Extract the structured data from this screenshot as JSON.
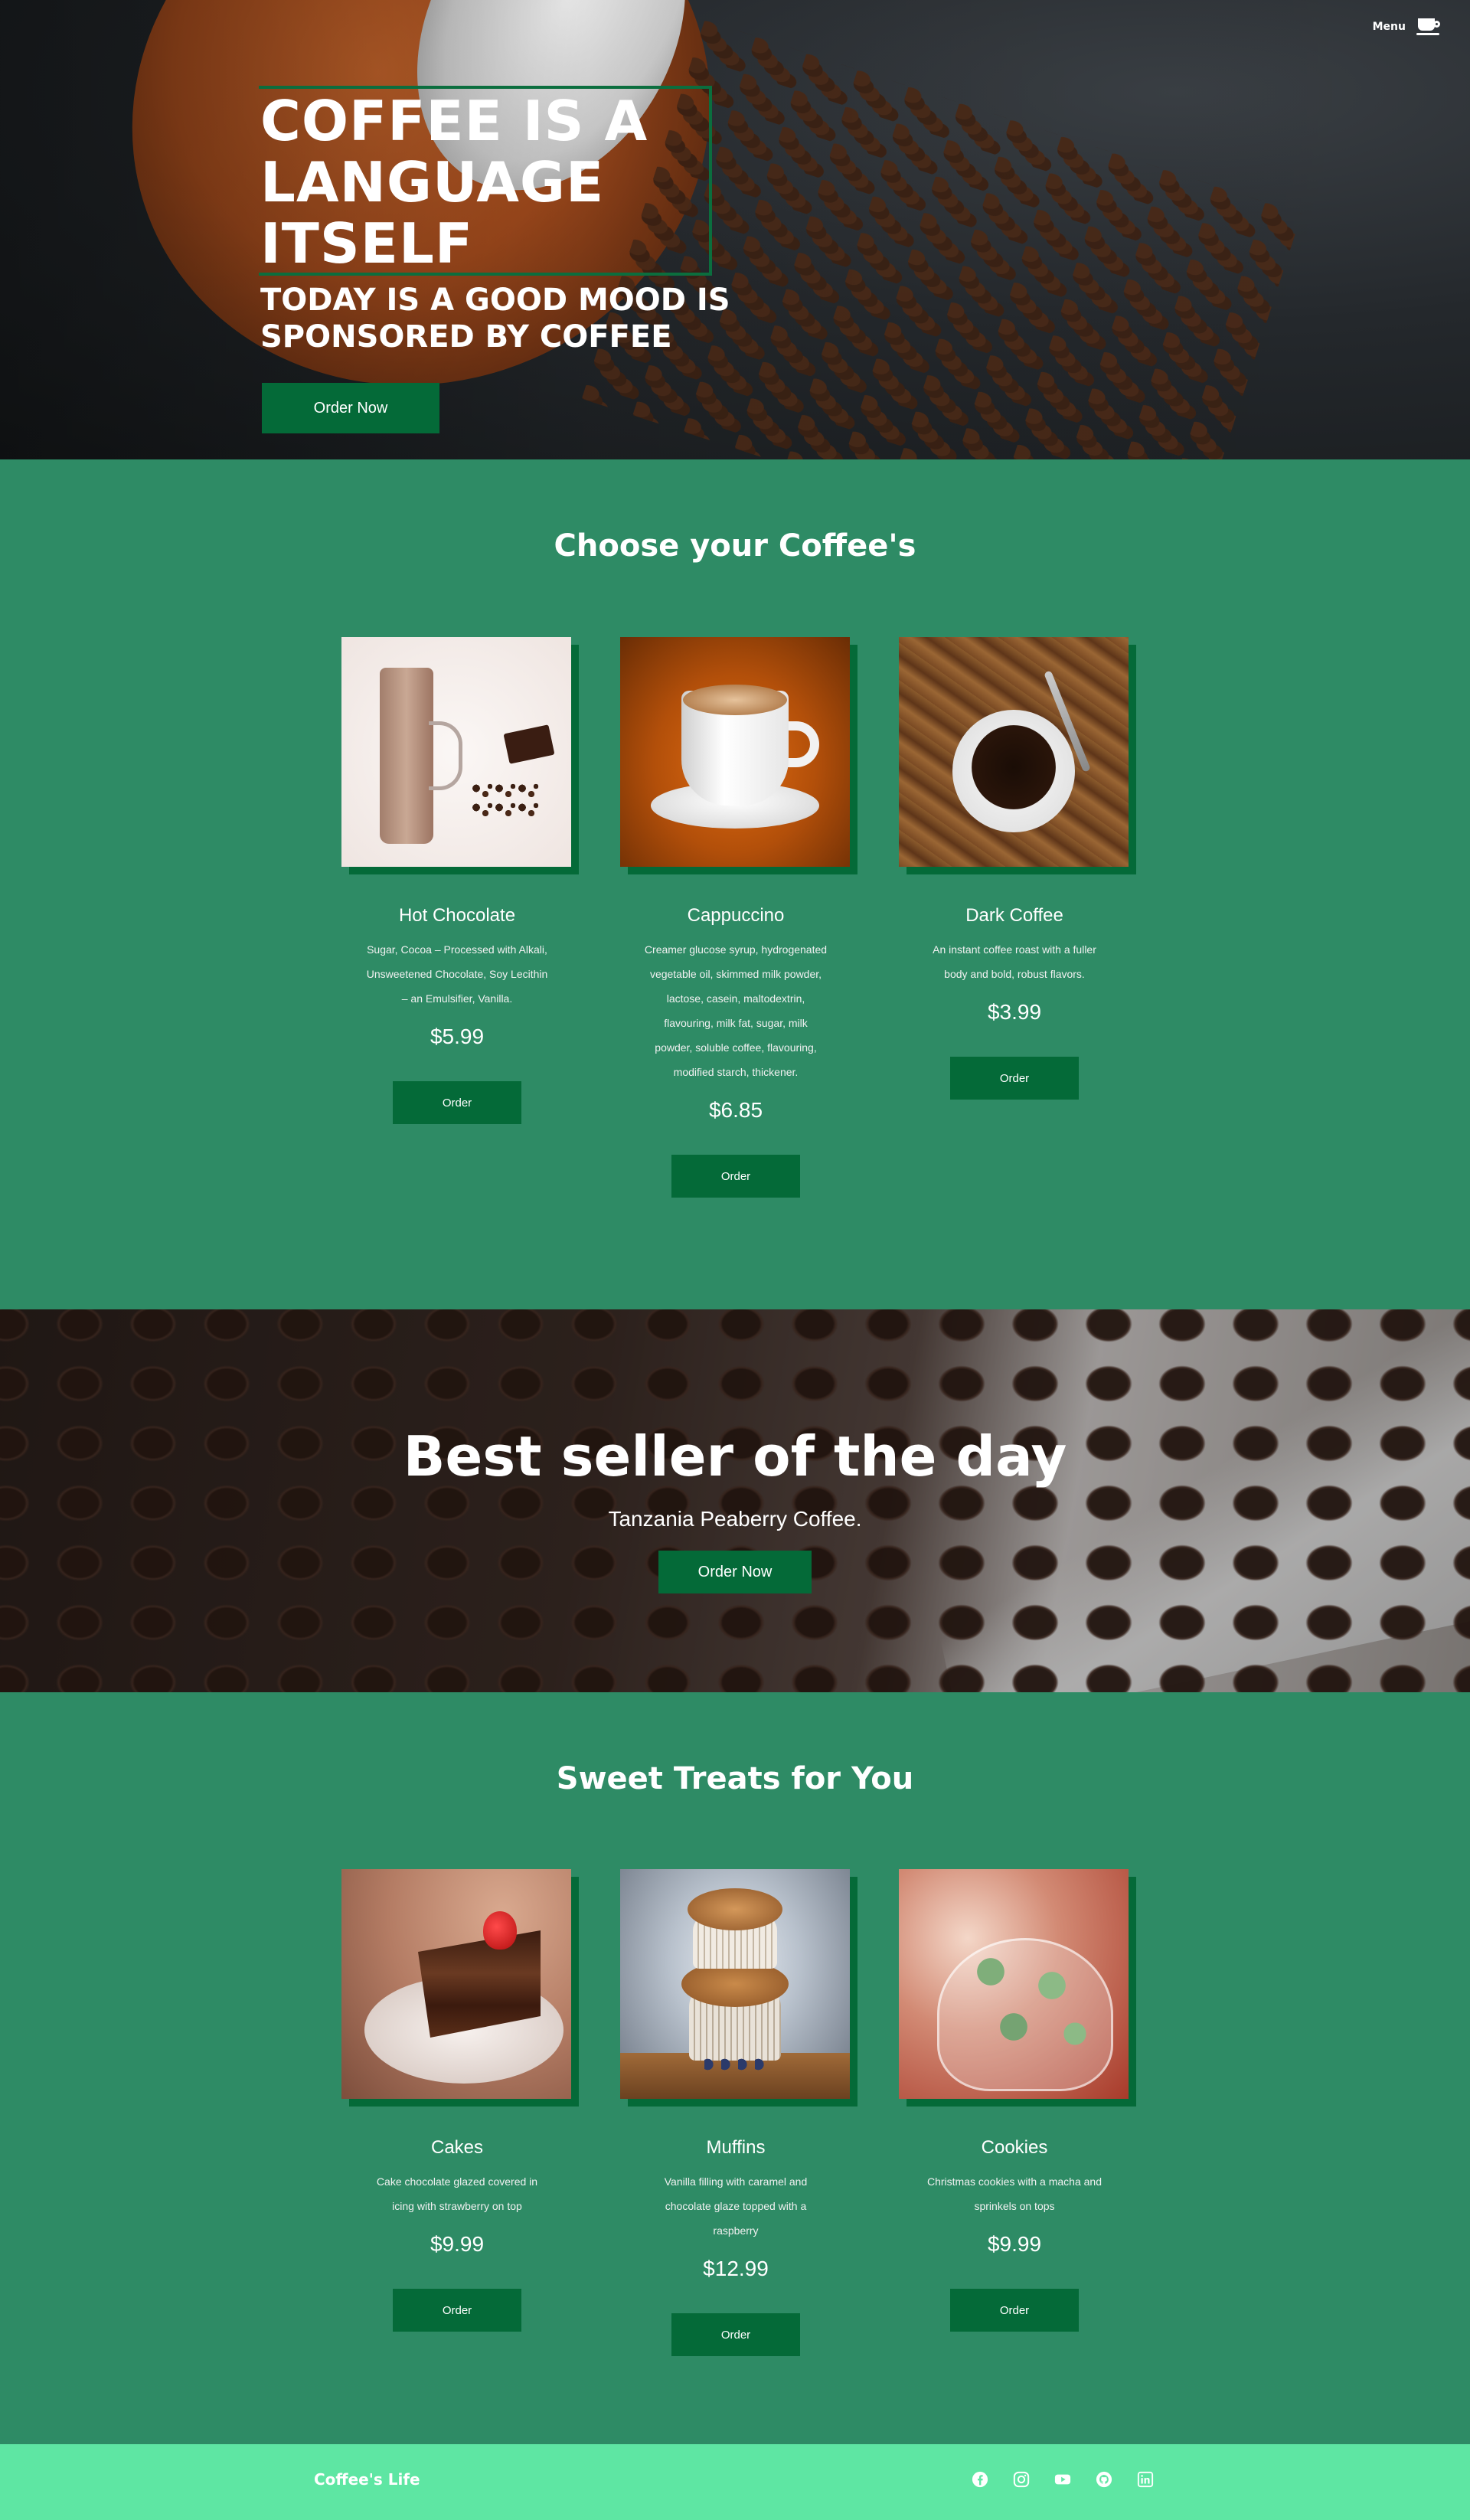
{
  "header": {
    "menu_label": "Menu",
    "menu_icon": "coffee-cup-icon"
  },
  "hero": {
    "title": "COFFEE IS A LANGUAGE ITSELF",
    "subtitle": "TODAY IS A GOOD MOOD IS SPONSORED BY COFFEE",
    "cta": "Order Now"
  },
  "coffees": {
    "title": "Choose your Coffee's",
    "items": [
      {
        "name": "Hot Chocolate",
        "desc": "Sugar, Cocoa – Processed with Alkali, Unsweetened Chocolate, Soy Lecithin – an Emulsifier, Vanilla.",
        "price": "$5.99",
        "order": "Order"
      },
      {
        "name": "Cappuccino",
        "desc": "Creamer glucose syrup, hydrogenated vegetable oil, skimmed milk powder, lactose, casein, maltodextrin, flavouring, milk fat, sugar, milk powder, soluble coffee, flavouring, modified starch, thickener.",
        "price": "$6.85",
        "order": "Order"
      },
      {
        "name": "Dark Coffee",
        "desc": "An instant coffee roast with a fuller body and bold, robust flavors.",
        "price": "$3.99",
        "order": "Order"
      }
    ]
  },
  "bestseller": {
    "title": "Best seller of the day",
    "product": "Tanzania Peaberry Coffee.",
    "cta": "Order Now"
  },
  "treats": {
    "title": "Sweet Treats for You",
    "items": [
      {
        "name": "Cakes",
        "desc": "Cake chocolate glazed covered in icing with strawberry on top",
        "price": "$9.99",
        "order": "Order"
      },
      {
        "name": "Muffins",
        "desc": "Vanilla filling with caramel and chocolate glaze topped with a raspberry",
        "price": "$12.99",
        "order": "Order"
      },
      {
        "name": "Cookies",
        "desc": "Christmas cookies with a macha and sprinkels on tops",
        "price": "$9.99",
        "order": "Order"
      }
    ]
  },
  "footer": {
    "brand": "Coffee's Life",
    "socials": [
      "facebook-icon",
      "instagram-icon",
      "youtube-icon",
      "github-icon",
      "linkedin-icon"
    ]
  },
  "colors": {
    "section_bg": "#2e8b65",
    "button": "#046a38",
    "footer_bg": "#5ee6a3"
  }
}
